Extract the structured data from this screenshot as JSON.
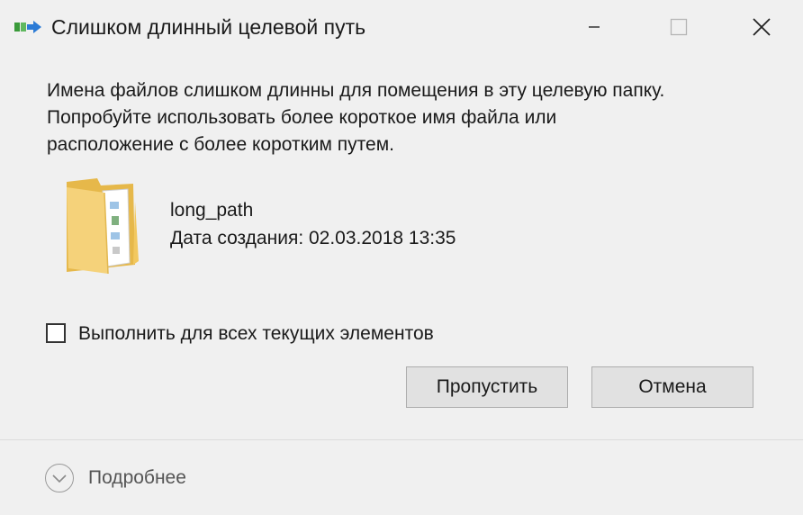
{
  "window": {
    "title": "Слишком длинный целевой путь",
    "title_icon": "file-move-icon",
    "controls": {
      "minimize_icon": "minimize-icon",
      "maximize_icon": "maximize-icon",
      "close_icon": "close-icon"
    }
  },
  "message": {
    "line1": "Имена файлов слишком длинны для помещения в эту целевую папку.",
    "line2": "Попробуйте использовать более короткое имя файла или",
    "line3": "расположение с более коротким путем."
  },
  "item": {
    "icon": "folder-icon",
    "name": "long_path",
    "date_label": "Дата создания: 02.03.2018 13:35"
  },
  "apply_all": {
    "label": "Выполнить для всех текущих элементов",
    "checked": false
  },
  "buttons": {
    "skip_label": "Пропустить",
    "cancel_label": "Отмена"
  },
  "details": {
    "label": "Подробнее",
    "icon": "chevron-down-icon"
  },
  "colors": {
    "background": "#f0f0f0",
    "button": "#e1e1e1",
    "button_border": "#adadad",
    "folder": "#f5d27a",
    "green_arrow": "#3a9a3a",
    "blue_arrow": "#2b7bd6"
  }
}
